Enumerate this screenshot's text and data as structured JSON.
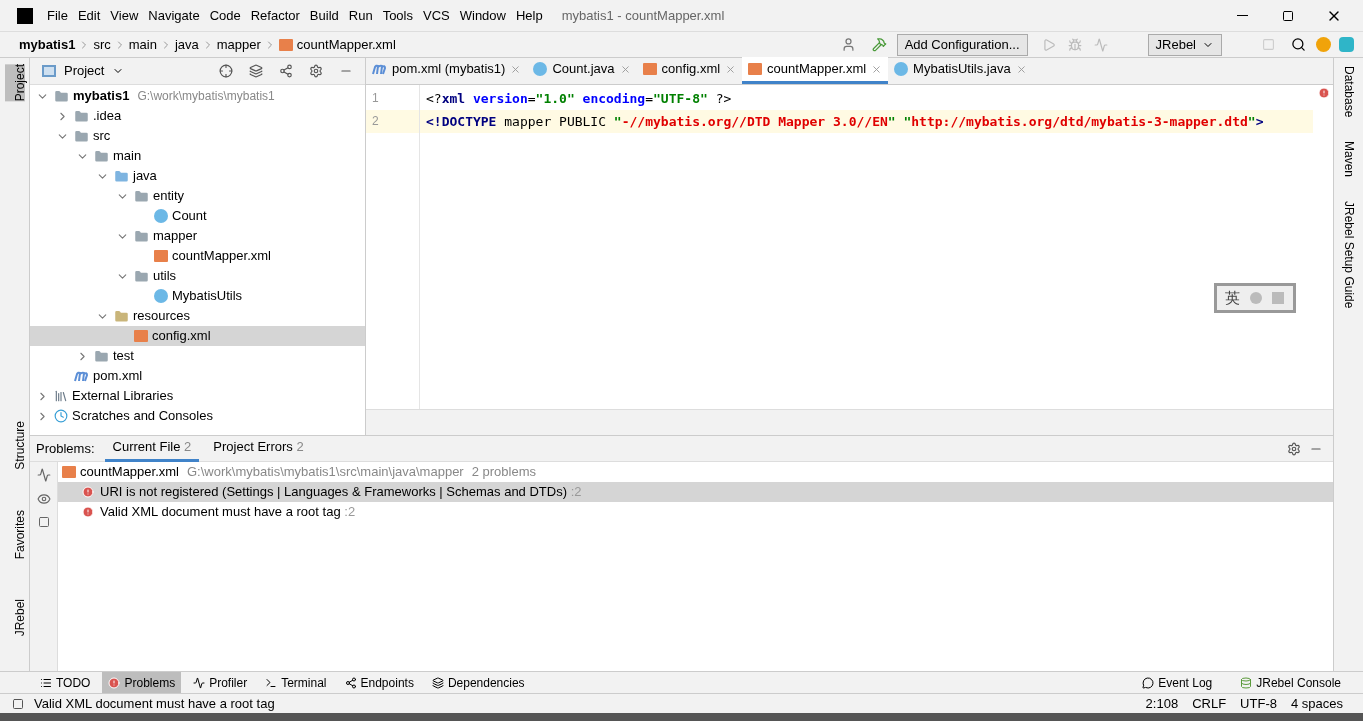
{
  "window": {
    "title": "mybatis1 - countMapper.xml"
  },
  "menu": [
    "File",
    "Edit",
    "View",
    "Navigate",
    "Code",
    "Refactor",
    "Build",
    "Run",
    "Tools",
    "VCS",
    "Window",
    "Help"
  ],
  "breadcrumb": [
    {
      "label": "mybatis1",
      "kind": "project"
    },
    {
      "label": "src",
      "kind": "folder"
    },
    {
      "label": "main",
      "kind": "folder"
    },
    {
      "label": "java",
      "kind": "folder"
    },
    {
      "label": "mapper",
      "kind": "folder"
    },
    {
      "label": "countMapper.xml",
      "kind": "xml"
    }
  ],
  "toolbar": {
    "run_config": "Add Configuration...",
    "jrebel": "JRebel"
  },
  "left_strip": [
    {
      "label": "Project",
      "selected": true
    },
    {
      "label": "Structure",
      "selected": false
    },
    {
      "label": "Favorites",
      "selected": false
    },
    {
      "label": "JRebel",
      "selected": false
    }
  ],
  "right_strip": [
    "Database",
    "Maven",
    "JRebel Setup Guide"
  ],
  "project_panel": {
    "title": "Project",
    "tree": [
      {
        "label": "mybatis1",
        "path": "G:\\work\\mybatis\\mybatis1",
        "kind": "module",
        "expanded": true,
        "selected": false,
        "children": [
          {
            "label": ".idea",
            "kind": "folder",
            "expanded": false,
            "selected": false
          },
          {
            "label": "src",
            "kind": "folder",
            "expanded": true,
            "selected": false,
            "children": [
              {
                "label": "main",
                "kind": "folder",
                "expanded": true,
                "selected": false,
                "children": [
                  {
                    "label": "java",
                    "kind": "source",
                    "expanded": true,
                    "selected": false,
                    "children": [
                      {
                        "label": "entity",
                        "kind": "folder",
                        "expanded": true,
                        "selected": false,
                        "children": [
                          {
                            "label": "Count",
                            "kind": "class",
                            "selected": false
                          }
                        ]
                      },
                      {
                        "label": "mapper",
                        "kind": "folder",
                        "expanded": true,
                        "selected": false,
                        "children": [
                          {
                            "label": "countMapper.xml",
                            "kind": "xml",
                            "selected": false
                          }
                        ]
                      },
                      {
                        "label": "utils",
                        "kind": "folder",
                        "expanded": true,
                        "selected": false,
                        "children": [
                          {
                            "label": "MybatisUtils",
                            "kind": "class",
                            "selected": false
                          }
                        ]
                      }
                    ]
                  },
                  {
                    "label": "resources",
                    "kind": "resources",
                    "expanded": true,
                    "selected": false,
                    "children": [
                      {
                        "label": "config.xml",
                        "kind": "xml",
                        "selected": true
                      }
                    ]
                  }
                ]
              },
              {
                "label": "test",
                "kind": "folder",
                "expanded": false,
                "selected": false
              }
            ]
          },
          {
            "label": "pom.xml",
            "kind": "maven",
            "selected": false
          }
        ]
      },
      {
        "label": "External Libraries",
        "kind": "libraries",
        "expanded": false,
        "selected": false
      },
      {
        "label": "Scratches and Consoles",
        "kind": "scratches",
        "expanded": false,
        "selected": false
      }
    ]
  },
  "editor_tabs": [
    {
      "label": "pom.xml (mybatis1)",
      "kind": "maven",
      "selected": false
    },
    {
      "label": "Count.java",
      "kind": "class",
      "selected": false
    },
    {
      "label": "config.xml",
      "kind": "xml",
      "selected": false
    },
    {
      "label": "countMapper.xml",
      "kind": "xml",
      "selected": true
    },
    {
      "label": "MybatisUtils.java",
      "kind": "class",
      "selected": false
    }
  ],
  "editor": {
    "lines": [
      {
        "number": "1",
        "current": false,
        "tokens": [
          {
            "text": "<?",
            "kind": "punct"
          },
          {
            "text": "xml ",
            "kind": "tag"
          },
          {
            "text": "version",
            "kind": "attr"
          },
          {
            "text": "=",
            "kind": "punct"
          },
          {
            "text": "\"1.0\" ",
            "kind": "value"
          },
          {
            "text": "encoding",
            "kind": "attr"
          },
          {
            "text": "=",
            "kind": "punct"
          },
          {
            "text": "\"UTF-8\" ",
            "kind": "value"
          },
          {
            "text": "?>",
            "kind": "punct"
          }
        ]
      },
      {
        "number": "2",
        "current": true,
        "tokens": [
          {
            "text": "<!DOCTYPE ",
            "kind": "tag"
          },
          {
            "text": "mapper PUBLIC ",
            "kind": "punct"
          },
          {
            "text": "\"",
            "kind": "value"
          },
          {
            "text": "-//mybatis.org//DTD Mapper 3.0//EN",
            "kind": "error"
          },
          {
            "text": "\" \"",
            "kind": "value"
          },
          {
            "text": "http://mybatis.org/dtd/mybatis-3-mapper.dtd",
            "kind": "error"
          },
          {
            "text": "\"",
            "kind": "value"
          },
          {
            "text": ">",
            "kind": "tag"
          }
        ]
      }
    ]
  },
  "ime_toolbar": {
    "label": "英"
  },
  "problems": {
    "title": "Problems:",
    "tabs": [
      {
        "label": "Current File",
        "count": "2",
        "selected": true
      },
      {
        "label": "Project Errors",
        "count": "2",
        "selected": false
      }
    ],
    "file": {
      "name": "countMapper.xml",
      "path": "G:\\work\\mybatis\\mybatis1\\src\\main\\java\\mapper",
      "summary": "2 problems"
    },
    "items": [
      {
        "message": "URI is not registered (Settings | Languages & Frameworks | Schemas and DTDs)",
        "line": ":2",
        "selected": true
      },
      {
        "message": "Valid XML document must have a root tag",
        "line": ":2",
        "selected": false
      }
    ]
  },
  "bottom_tabs": [
    {
      "label": "TODO",
      "kind": "list",
      "selected": false
    },
    {
      "label": "Problems",
      "kind": "error",
      "selected": true
    },
    {
      "label": "Profiler",
      "kind": "profiler",
      "selected": false
    },
    {
      "label": "Terminal",
      "kind": "terminal",
      "selected": false
    },
    {
      "label": "Endpoints",
      "kind": "endpoints",
      "selected": false
    },
    {
      "label": "Dependencies",
      "kind": "layers",
      "selected": false
    }
  ],
  "bottom_right_tabs": [
    {
      "label": "Event Log",
      "kind": "log"
    },
    {
      "label": "JRebel Console",
      "kind": "jrebel"
    }
  ],
  "status_bar": {
    "message": "Valid XML document must have a root tag",
    "items": [
      "2:108",
      "CRLF",
      "UTF-8",
      "4 spaces"
    ]
  }
}
